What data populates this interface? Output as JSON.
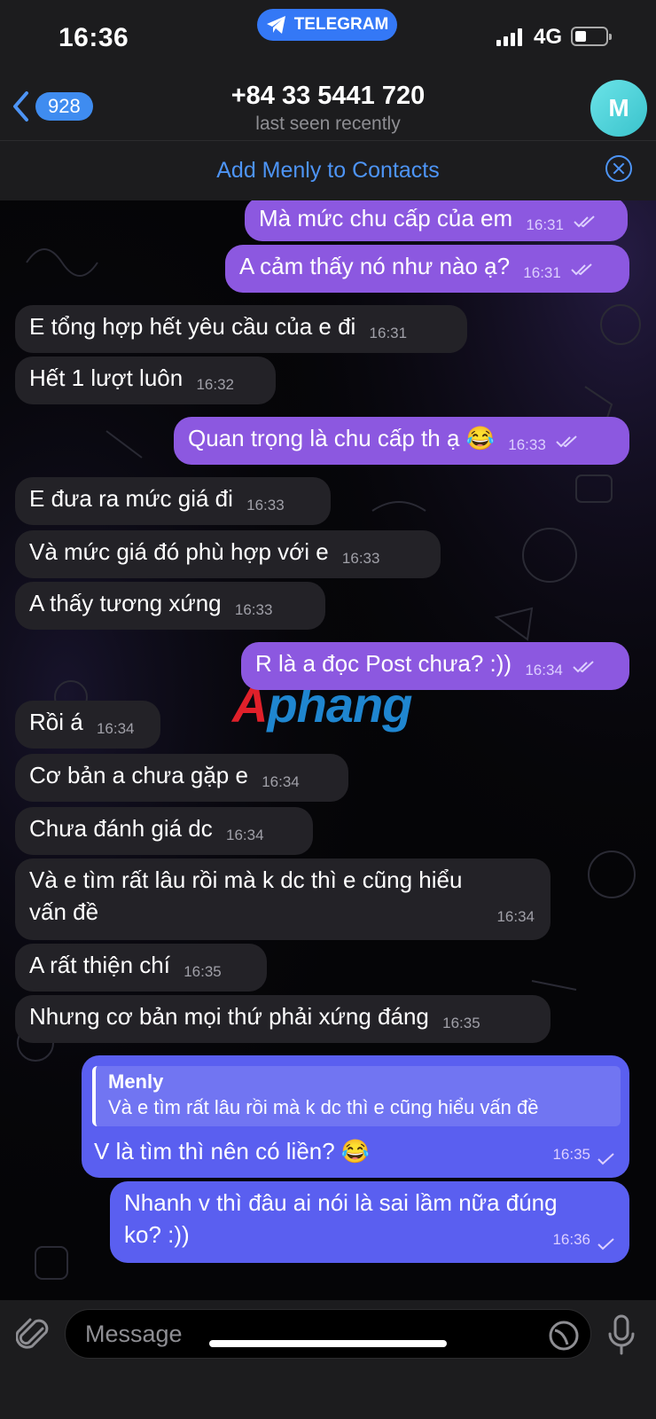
{
  "status_bar": {
    "time": "16:36",
    "app_pill": "TELEGRAM",
    "network": "4G"
  },
  "header": {
    "back_count": "928",
    "title": "+84 33 5441 720",
    "subtitle": "last seen recently",
    "avatar_letter": "M"
  },
  "add_contact": {
    "label": "Add Menly to Contacts"
  },
  "watermark": {
    "part1": "A",
    "part2": "phang"
  },
  "messages": [
    {
      "dir": "out",
      "text": "Mà mức chu cấp của em",
      "time": "16:31",
      "status": "read"
    },
    {
      "dir": "out",
      "text": "A cảm thấy nó như nào ạ?",
      "time": "16:31",
      "status": "read"
    },
    {
      "dir": "in",
      "text": "E tổng hợp hết yêu cầu của e đi",
      "time": "16:31"
    },
    {
      "dir": "in",
      "text": "Hết 1 lượt luôn",
      "time": "16:32"
    },
    {
      "dir": "out",
      "text": "Quan trọng là chu cấp th ạ 😂",
      "time": "16:33",
      "status": "read"
    },
    {
      "dir": "in",
      "text": "E đưa ra mức giá đi",
      "time": "16:33"
    },
    {
      "dir": "in",
      "text": "Và mức giá đó phù hợp với e",
      "time": "16:33"
    },
    {
      "dir": "in",
      "text": "A thấy tương xứng",
      "time": "16:33"
    },
    {
      "dir": "out",
      "text": "R là a đọc Post chưa? :))",
      "time": "16:34",
      "status": "read"
    },
    {
      "dir": "in",
      "text": "Rồi á",
      "time": "16:34"
    },
    {
      "dir": "in",
      "text": "Cơ bản a chưa gặp e",
      "time": "16:34"
    },
    {
      "dir": "in",
      "text": "Chưa đánh giá dc",
      "time": "16:34"
    },
    {
      "dir": "in",
      "text_line1": "Và e tìm rất lâu rồi mà k dc thì e cũng hiểu",
      "text_line2": "vấn đề",
      "time": "16:34"
    },
    {
      "dir": "in",
      "text": "A rất thiện chí",
      "time": "16:35"
    },
    {
      "dir": "in",
      "text": "Nhưng cơ bản mọi thứ phải xứng đáng",
      "time": "16:35"
    },
    {
      "dir": "out",
      "reply_name": "Menly",
      "reply_text": "Và e tìm rất lâu rồi mà k dc thì e cũng hiểu vấn đề",
      "text": "V là tìm thì nên có liền? 😂",
      "time": "16:35",
      "status": "sent"
    },
    {
      "dir": "out",
      "text_line1": "Nhanh v thì đâu ai nói là sai lầm nữa đúng",
      "text_line2": "ko? :))",
      "time": "16:36",
      "status": "sent"
    }
  ],
  "composer": {
    "placeholder": "Message"
  },
  "colors": {
    "incoming_bubble": "#232227",
    "outgoing_purple": "#8c58e0",
    "outgoing_blue": "#5a5ff0",
    "accent": "#4d94f5"
  }
}
